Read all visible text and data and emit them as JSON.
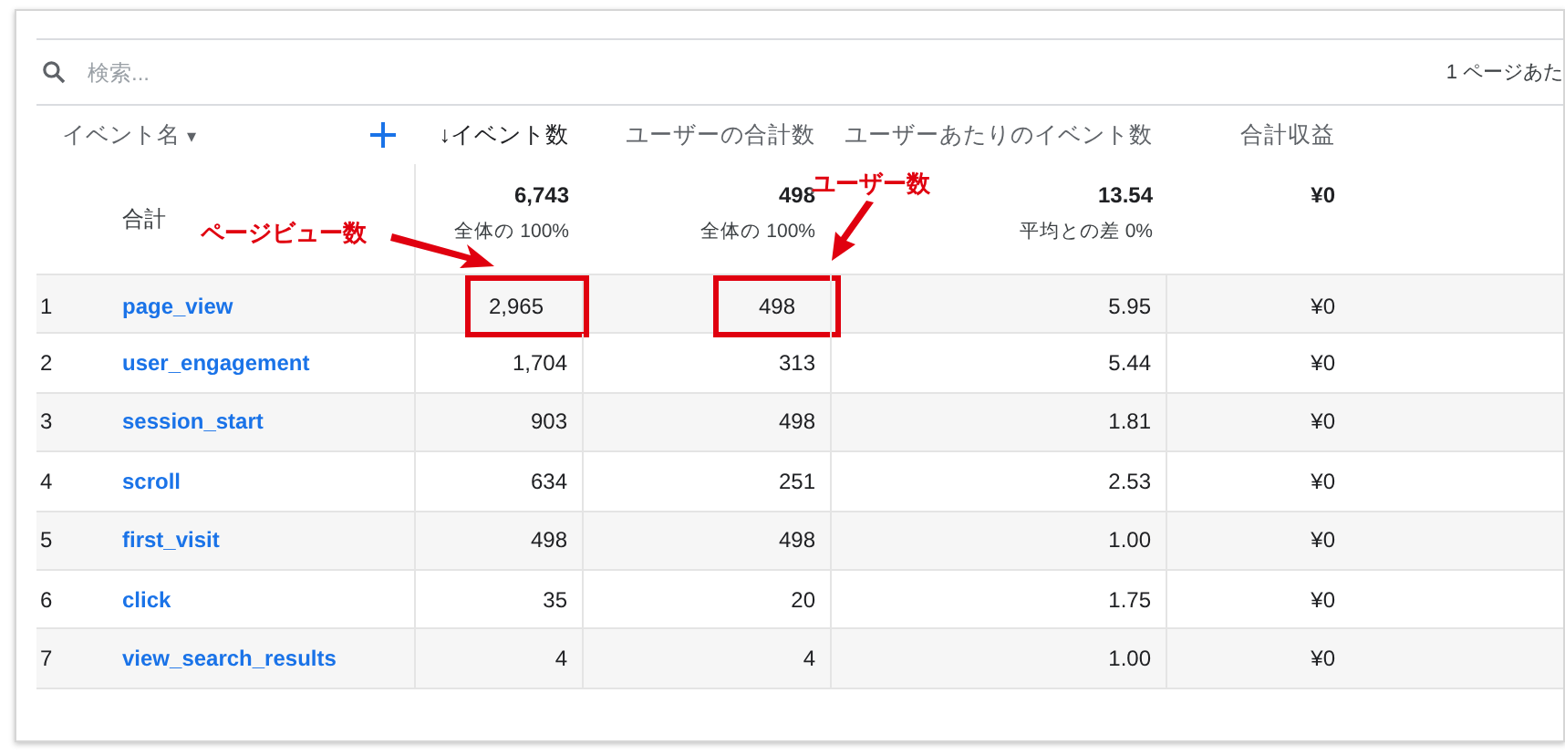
{
  "search": {
    "placeholder": "検索..."
  },
  "pagination": {
    "label": "1 ページあた"
  },
  "table": {
    "name_column": {
      "label": "イベント名",
      "sort_caret": "▾"
    },
    "columns": [
      {
        "label": "↓イベント数"
      },
      {
        "label": "ユーザーの合計数"
      },
      {
        "label": "ユーザーあたりのイベント数"
      },
      {
        "label": "合計収益"
      }
    ],
    "totals": {
      "label": "合計",
      "cells": [
        {
          "value": "6,743",
          "note": "全体の 100%"
        },
        {
          "value": "498",
          "note": "全体の 100%"
        },
        {
          "value": "13.54",
          "note": "平均との差 0%"
        },
        {
          "value": "¥0"
        }
      ]
    },
    "rows": [
      {
        "index": "1",
        "name": "page_view",
        "cells": [
          {
            "text": "2,965",
            "boxed": true
          },
          {
            "text": "498",
            "boxed": true
          },
          {
            "text": "5.95",
            "boxed": false
          },
          {
            "text": "¥0",
            "boxed": false
          }
        ]
      },
      {
        "index": "2",
        "name": "user_engagement",
        "cells": [
          {
            "text": "1,704",
            "boxed": false
          },
          {
            "text": "313",
            "boxed": false
          },
          {
            "text": "5.44",
            "boxed": false
          },
          {
            "text": "¥0",
            "boxed": false
          }
        ]
      },
      {
        "index": "3",
        "name": "session_start",
        "cells": [
          {
            "text": "903",
            "boxed": false
          },
          {
            "text": "498",
            "boxed": false
          },
          {
            "text": "1.81",
            "boxed": false
          },
          {
            "text": "¥0",
            "boxed": false
          }
        ]
      },
      {
        "index": "4",
        "name": "scroll",
        "cells": [
          {
            "text": "634",
            "boxed": false
          },
          {
            "text": "251",
            "boxed": false
          },
          {
            "text": "2.53",
            "boxed": false
          },
          {
            "text": "¥0",
            "boxed": false
          }
        ]
      },
      {
        "index": "5",
        "name": "first_visit",
        "cells": [
          {
            "text": "498",
            "boxed": false
          },
          {
            "text": "498",
            "boxed": false
          },
          {
            "text": "1.00",
            "boxed": false
          },
          {
            "text": "¥0",
            "boxed": false
          }
        ]
      },
      {
        "index": "6",
        "name": "click",
        "cells": [
          {
            "text": "35",
            "boxed": false
          },
          {
            "text": "20",
            "boxed": false
          },
          {
            "text": "1.75",
            "boxed": false
          },
          {
            "text": "¥0",
            "boxed": false
          }
        ]
      },
      {
        "index": "7",
        "name": "view_search_results",
        "cells": [
          {
            "text": "4",
            "boxed": false
          },
          {
            "text": "4",
            "boxed": false
          },
          {
            "text": "1.00",
            "boxed": false
          },
          {
            "text": "¥0",
            "boxed": false
          }
        ]
      }
    ]
  },
  "callouts": [
    {
      "text": "ページビュー数"
    },
    {
      "text": "ユーザー数"
    }
  ]
}
